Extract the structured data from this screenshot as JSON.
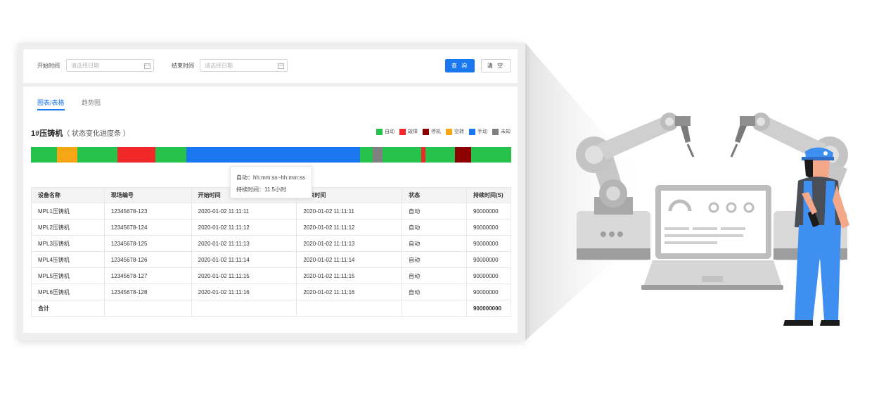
{
  "filter": {
    "start_label": "开始时间",
    "start_placeholder": "请选择日期",
    "end_label": "结束时间",
    "end_placeholder": "请选择日期",
    "query_button": "查 询",
    "clear_button": "清 空"
  },
  "tabs": [
    "图表/表格",
    "趋势图"
  ],
  "chart": {
    "title_main": "1#压铸机",
    "title_sub": "（ 状态变化进度条 ）"
  },
  "legend": [
    {
      "label": "自动",
      "color": "#27c24c"
    },
    {
      "label": "故障",
      "color": "#f02828"
    },
    {
      "label": "停机",
      "color": "#8c0000"
    },
    {
      "label": "空转",
      "color": "#f7a716"
    },
    {
      "label": "手动",
      "color": "#1a77f0"
    },
    {
      "label": "未知",
      "color": "#808080"
    }
  ],
  "chart_data": {
    "type": "bar",
    "categories": [
      "自动",
      "空转",
      "自动",
      "故障",
      "自动",
      "手动",
      "自动",
      "未知",
      "自动",
      "故障",
      "自动",
      "停机",
      "自动"
    ],
    "values": [
      5.4,
      4.3,
      8.4,
      7.9,
      6.5,
      36.4,
      2.6,
      2.1,
      8.0,
      0.9,
      6.2,
      3.4,
      8.4
    ],
    "colors": [
      "#27c24c",
      "#f7a716",
      "#27c24c",
      "#f02828",
      "#27c24c",
      "#1a77f0",
      "#27c24c",
      "#808080",
      "#27c24c",
      "#f02828",
      "#27c24c",
      "#8c0000",
      "#27c24c"
    ]
  },
  "tooltip": {
    "line1": "自动：hh:mm:ss~hh:mm:ss",
    "line2": "持续时间：11.5小时"
  },
  "table": {
    "headers": [
      "设备名称",
      "现场编号",
      "开始时间",
      "结束时间",
      "状态",
      "持续时间(S)"
    ],
    "rows": [
      [
        "MPL1压铸机",
        "12345678-123",
        "2020-01-02  11:11:11",
        "2020-01-02  11:11:11",
        "自动",
        "90000000"
      ],
      [
        "MPL2压铸机",
        "12345678-124",
        "2020-01-02  11:11:12",
        "2020-01-02  11:11:12",
        "自动",
        "90000000"
      ],
      [
        "MPL3压铸机",
        "12345678-125",
        "2020-01-02  11:11:13",
        "2020-01-02  11:11:13",
        "自动",
        "90000000"
      ],
      [
        "MPL4压铸机",
        "12345678-126",
        "2020-01-02  11:11:14",
        "2020-01-02  11:11:14",
        "自动",
        "90000000"
      ],
      [
        "MPL5压铸机",
        "12345678-127",
        "2020-01-02  11:11:15",
        "2020-01-02  11:11:15",
        "自动",
        "90000000"
      ],
      [
        "MPL6压铸机",
        "12345678-128",
        "2020-01-02  11:11:16",
        "2020-01-02  11:11:16",
        "自动",
        "90000000"
      ]
    ],
    "total_label": "合计",
    "total_value": "900000000"
  }
}
